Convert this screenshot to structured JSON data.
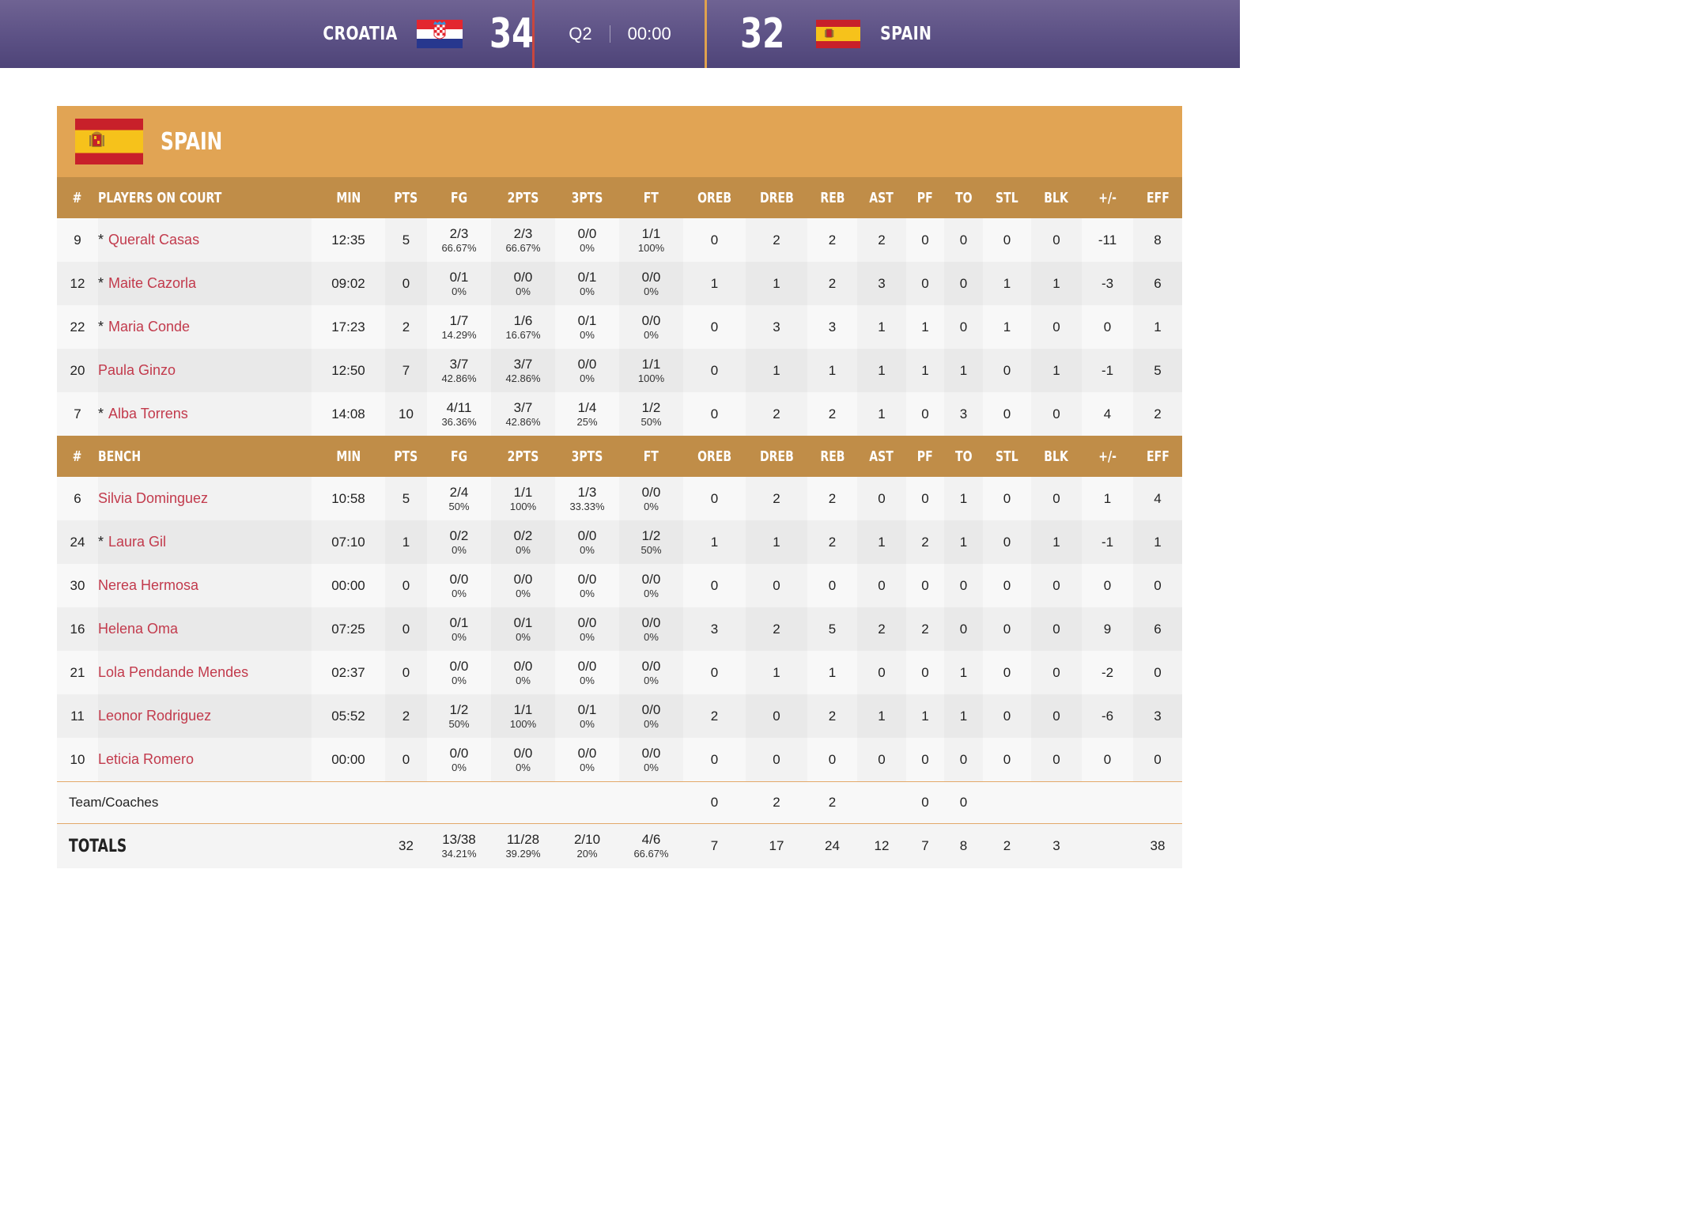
{
  "scoreboard": {
    "home_name": "CROATIA",
    "home_score": "34",
    "period": "Q2",
    "clock": "00:00",
    "away_score": "32",
    "away_name": "SPAIN"
  },
  "team": {
    "name": "SPAIN"
  },
  "colors": {
    "header": "#e1a454",
    "subheader": "#c08d48",
    "score_bar": "#5c5185",
    "player_link": "#c23a4c"
  },
  "columns": [
    "#",
    "MIN",
    "PTS",
    "FG",
    "2PTS",
    "3PTS",
    "FT",
    "OREB",
    "DREB",
    "REB",
    "AST",
    "PF",
    "TO",
    "STL",
    "BLK",
    "+/-",
    "EFF"
  ],
  "section_labels": {
    "on_court": "PLAYERS ON COURT",
    "bench": "BENCH"
  },
  "on_court": [
    {
      "num": "9",
      "star": "*",
      "name": "Queralt Casas",
      "min": "12:35",
      "pts": "5",
      "fg": "2/3",
      "fg_pct": "66.67%",
      "p2": "2/3",
      "p2_pct": "66.67%",
      "p3": "0/0",
      "p3_pct": "0%",
      "ft": "1/1",
      "ft_pct": "100%",
      "oreb": "0",
      "dreb": "2",
      "reb": "2",
      "ast": "2",
      "pf": "0",
      "to": "0",
      "stl": "0",
      "blk": "0",
      "pm": "-11",
      "eff": "8"
    },
    {
      "num": "12",
      "star": "*",
      "name": "Maite Cazorla",
      "min": "09:02",
      "pts": "0",
      "fg": "0/1",
      "fg_pct": "0%",
      "p2": "0/0",
      "p2_pct": "0%",
      "p3": "0/1",
      "p3_pct": "0%",
      "ft": "0/0",
      "ft_pct": "0%",
      "oreb": "1",
      "dreb": "1",
      "reb": "2",
      "ast": "3",
      "pf": "0",
      "to": "0",
      "stl": "1",
      "blk": "1",
      "pm": "-3",
      "eff": "6"
    },
    {
      "num": "22",
      "star": "*",
      "name": "Maria Conde",
      "min": "17:23",
      "pts": "2",
      "fg": "1/7",
      "fg_pct": "14.29%",
      "p2": "1/6",
      "p2_pct": "16.67%",
      "p3": "0/1",
      "p3_pct": "0%",
      "ft": "0/0",
      "ft_pct": "0%",
      "oreb": "0",
      "dreb": "3",
      "reb": "3",
      "ast": "1",
      "pf": "1",
      "to": "0",
      "stl": "1",
      "blk": "0",
      "pm": "0",
      "eff": "1"
    },
    {
      "num": "20",
      "star": "",
      "name": "Paula Ginzo",
      "min": "12:50",
      "pts": "7",
      "fg": "3/7",
      "fg_pct": "42.86%",
      "p2": "3/7",
      "p2_pct": "42.86%",
      "p3": "0/0",
      "p3_pct": "0%",
      "ft": "1/1",
      "ft_pct": "100%",
      "oreb": "0",
      "dreb": "1",
      "reb": "1",
      "ast": "1",
      "pf": "1",
      "to": "1",
      "stl": "0",
      "blk": "1",
      "pm": "-1",
      "eff": "5"
    },
    {
      "num": "7",
      "star": "*",
      "name": "Alba Torrens",
      "min": "14:08",
      "pts": "10",
      "fg": "4/11",
      "fg_pct": "36.36%",
      "p2": "3/7",
      "p2_pct": "42.86%",
      "p3": "1/4",
      "p3_pct": "25%",
      "ft": "1/2",
      "ft_pct": "50%",
      "oreb": "0",
      "dreb": "2",
      "reb": "2",
      "ast": "1",
      "pf": "0",
      "to": "3",
      "stl": "0",
      "blk": "0",
      "pm": "4",
      "eff": "2"
    }
  ],
  "bench": [
    {
      "num": "6",
      "star": "",
      "name": "Silvia Dominguez",
      "min": "10:58",
      "pts": "5",
      "fg": "2/4",
      "fg_pct": "50%",
      "p2": "1/1",
      "p2_pct": "100%",
      "p3": "1/3",
      "p3_pct": "33.33%",
      "ft": "0/0",
      "ft_pct": "0%",
      "oreb": "0",
      "dreb": "2",
      "reb": "2",
      "ast": "0",
      "pf": "0",
      "to": "1",
      "stl": "0",
      "blk": "0",
      "pm": "1",
      "eff": "4"
    },
    {
      "num": "24",
      "star": "*",
      "name": "Laura Gil",
      "min": "07:10",
      "pts": "1",
      "fg": "0/2",
      "fg_pct": "0%",
      "p2": "0/2",
      "p2_pct": "0%",
      "p3": "0/0",
      "p3_pct": "0%",
      "ft": "1/2",
      "ft_pct": "50%",
      "oreb": "1",
      "dreb": "1",
      "reb": "2",
      "ast": "1",
      "pf": "2",
      "to": "1",
      "stl": "0",
      "blk": "1",
      "pm": "-1",
      "eff": "1"
    },
    {
      "num": "30",
      "star": "",
      "name": "Nerea Hermosa",
      "min": "00:00",
      "pts": "0",
      "fg": "0/0",
      "fg_pct": "0%",
      "p2": "0/0",
      "p2_pct": "0%",
      "p3": "0/0",
      "p3_pct": "0%",
      "ft": "0/0",
      "ft_pct": "0%",
      "oreb": "0",
      "dreb": "0",
      "reb": "0",
      "ast": "0",
      "pf": "0",
      "to": "0",
      "stl": "0",
      "blk": "0",
      "pm": "0",
      "eff": "0"
    },
    {
      "num": "16",
      "star": "",
      "name": "Helena Oma",
      "min": "07:25",
      "pts": "0",
      "fg": "0/1",
      "fg_pct": "0%",
      "p2": "0/1",
      "p2_pct": "0%",
      "p3": "0/0",
      "p3_pct": "0%",
      "ft": "0/0",
      "ft_pct": "0%",
      "oreb": "3",
      "dreb": "2",
      "reb": "5",
      "ast": "2",
      "pf": "2",
      "to": "0",
      "stl": "0",
      "blk": "0",
      "pm": "9",
      "eff": "6"
    },
    {
      "num": "21",
      "star": "",
      "name": "Lola Pendande Mendes",
      "min": "02:37",
      "pts": "0",
      "fg": "0/0",
      "fg_pct": "0%",
      "p2": "0/0",
      "p2_pct": "0%",
      "p3": "0/0",
      "p3_pct": "0%",
      "ft": "0/0",
      "ft_pct": "0%",
      "oreb": "0",
      "dreb": "1",
      "reb": "1",
      "ast": "0",
      "pf": "0",
      "to": "1",
      "stl": "0",
      "blk": "0",
      "pm": "-2",
      "eff": "0"
    },
    {
      "num": "11",
      "star": "",
      "name": "Leonor Rodriguez",
      "min": "05:52",
      "pts": "2",
      "fg": "1/2",
      "fg_pct": "50%",
      "p2": "1/1",
      "p2_pct": "100%",
      "p3": "0/1",
      "p3_pct": "0%",
      "ft": "0/0",
      "ft_pct": "0%",
      "oreb": "2",
      "dreb": "0",
      "reb": "2",
      "ast": "1",
      "pf": "1",
      "to": "1",
      "stl": "0",
      "blk": "0",
      "pm": "-6",
      "eff": "3"
    },
    {
      "num": "10",
      "star": "",
      "name": "Leticia Romero",
      "min": "00:00",
      "pts": "0",
      "fg": "0/0",
      "fg_pct": "0%",
      "p2": "0/0",
      "p2_pct": "0%",
      "p3": "0/0",
      "p3_pct": "0%",
      "ft": "0/0",
      "ft_pct": "0%",
      "oreb": "0",
      "dreb": "0",
      "reb": "0",
      "ast": "0",
      "pf": "0",
      "to": "0",
      "stl": "0",
      "blk": "0",
      "pm": "0",
      "eff": "0"
    }
  ],
  "team_coaches": {
    "label": "Team/Coaches",
    "oreb": "0",
    "dreb": "2",
    "reb": "2",
    "pf": "0",
    "to": "0"
  },
  "totals": {
    "label": "TOTALS",
    "pts": "32",
    "fg": "13/38",
    "fg_pct": "34.21%",
    "p2": "11/28",
    "p2_pct": "39.29%",
    "p3": "2/10",
    "p3_pct": "20%",
    "ft": "4/6",
    "ft_pct": "66.67%",
    "oreb": "7",
    "dreb": "17",
    "reb": "24",
    "ast": "12",
    "pf": "7",
    "to": "8",
    "stl": "2",
    "blk": "3",
    "pm": "",
    "eff": "38"
  }
}
